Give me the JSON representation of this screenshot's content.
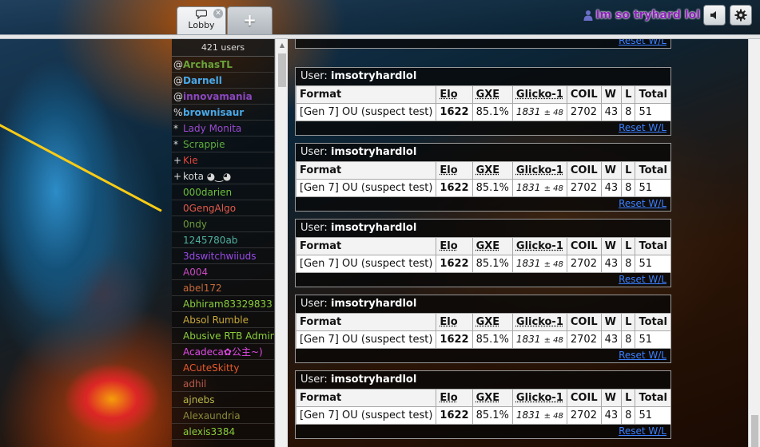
{
  "tabs": {
    "lobby_label": "Lobby",
    "close_glyph": "✕",
    "new_tab_glyph": "+"
  },
  "header": {
    "username": "Im so tryhard lol",
    "user_icon": "person-icon",
    "sound_icon": "speaker-icon",
    "settings_icon": "gear-icon",
    "username_color": "#8b1fb8"
  },
  "userlist": {
    "count_label": "421 users",
    "users": [
      {
        "rank": "@",
        "name": "ArchasTL",
        "color": "#6aa33a",
        "bold": true
      },
      {
        "rank": "@",
        "name": "Darnell",
        "color": "#4aa8e8",
        "bold": true
      },
      {
        "rank": "@",
        "name": "innovamania",
        "color": "#8a47c0",
        "bold": true
      },
      {
        "rank": "%",
        "name": "brownisaur",
        "color": "#4aa8e8",
        "bold": true
      },
      {
        "rank": "*",
        "name": "Lady Monita",
        "color": "#9a4ad0",
        "bold": false
      },
      {
        "rank": "*",
        "name": "Scrappie",
        "color": "#5fae3c",
        "bold": false
      },
      {
        "rank": "+",
        "name": "Kie",
        "color": "#e0453a",
        "bold": false
      },
      {
        "rank": "+",
        "name": "kota ◕‿◕",
        "color": "#d8d8d8",
        "bold": false
      },
      {
        "rank": "",
        "name": "000darien",
        "color": "#6cbf3a",
        "bold": false
      },
      {
        "rank": "",
        "name": "0GengAlgo",
        "color": "#e35a4a",
        "bold": false
      },
      {
        "rank": "",
        "name": "0ndy",
        "color": "#6b9a3a",
        "bold": false
      },
      {
        "rank": "",
        "name": "1245780ab",
        "color": "#4fb0a0",
        "bold": false
      },
      {
        "rank": "",
        "name": "3dswitchwiiuds",
        "color": "#9a4ae8",
        "bold": false
      },
      {
        "rank": "",
        "name": "A004",
        "color": "#c84ac0",
        "bold": false
      },
      {
        "rank": "",
        "name": "abel172",
        "color": "#c86a3a",
        "bold": false
      },
      {
        "rank": "",
        "name": "Abhiram83329833",
        "color": "#8ad03a",
        "bold": false
      },
      {
        "rank": "",
        "name": "Absol Rumble",
        "color": "#c8a83a",
        "bold": false
      },
      {
        "rank": "",
        "name": "Abusive RTB Admin",
        "color": "#8acf3a",
        "bold": false
      },
      {
        "rank": "",
        "name": "Acadeca✿公主~)",
        "color": "#e24ae8",
        "bold": false
      },
      {
        "rank": "",
        "name": "ACuteSkitty",
        "color": "#e85a2a",
        "bold": false
      },
      {
        "rank": "",
        "name": "adhil",
        "color": "#b85a4a",
        "bold": false
      },
      {
        "rank": "",
        "name": "ajnebs",
        "color": "#b8b84a",
        "bold": false
      },
      {
        "rank": "",
        "name": "Alexaundria",
        "color": "#8a8a3a",
        "bold": false
      },
      {
        "rank": "",
        "name": "alexis3384",
        "color": "#8acf3a",
        "bold": false
      }
    ]
  },
  "ladder": {
    "user_prefix": "User:",
    "user": "imsotryhardlol",
    "headers": [
      "Format",
      "Elo",
      "GXE",
      "Glicko-1",
      "COIL",
      "W",
      "L",
      "Total"
    ],
    "row": {
      "format": "[Gen 7] OU (suspect test)",
      "elo": "1622",
      "gxe": "85.1%",
      "glicko_main": "1831",
      "glicko_dev": "± 48",
      "coil": "2702",
      "w": "43",
      "l": "8",
      "total": "51"
    },
    "reset_label": "Reset W/L"
  }
}
